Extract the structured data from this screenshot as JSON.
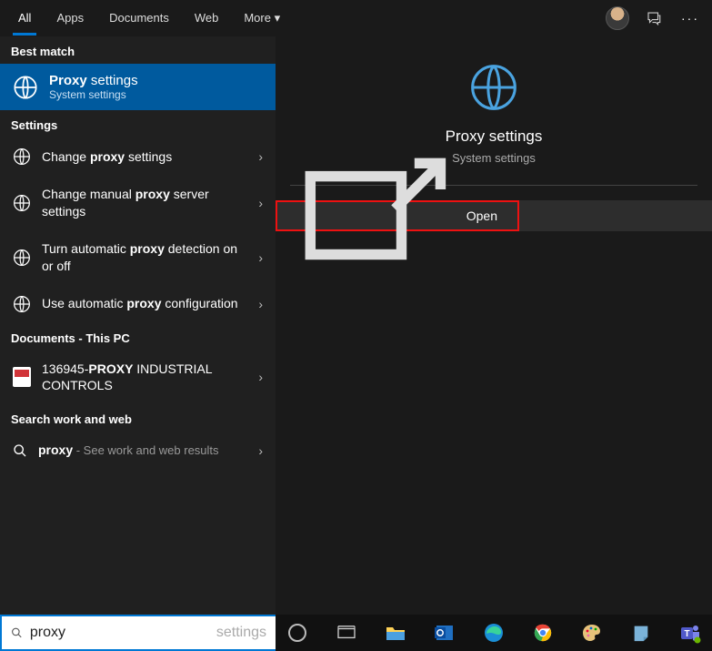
{
  "header": {
    "tabs": [
      "All",
      "Apps",
      "Documents",
      "Web",
      "More"
    ],
    "active_tab_index": 0,
    "chevron": "▾"
  },
  "left": {
    "best_match_label": "Best match",
    "best_match": {
      "title_bold": "Proxy",
      "title_rest": " settings",
      "subtitle": "System settings"
    },
    "settings_label": "Settings",
    "settings": [
      {
        "pre": "Change ",
        "bold": "proxy",
        "post": " settings"
      },
      {
        "pre": "Change manual ",
        "bold": "proxy",
        "post": " server settings"
      },
      {
        "pre": "Turn automatic ",
        "bold": "proxy",
        "post": " detection on or off"
      },
      {
        "pre": "Use automatic ",
        "bold": "proxy",
        "post": " configuration"
      }
    ],
    "documents_label": "Documents - This PC",
    "documents": [
      {
        "pre": "136945-",
        "bold": "PROXY",
        "post": " INDUSTRIAL CONTROLS"
      }
    ],
    "web_label": "Search work and web",
    "web": [
      {
        "bold": "proxy",
        "sub": " - See work and web results"
      }
    ]
  },
  "right": {
    "title": "Proxy settings",
    "subtitle": "System settings",
    "open_label": "Open"
  },
  "search": {
    "value": "proxy",
    "placeholder": "settings"
  }
}
